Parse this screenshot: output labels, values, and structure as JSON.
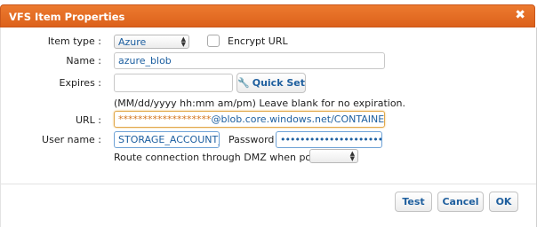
{
  "window": {
    "title": "VFS Item Properties",
    "close_glyph": "✖"
  },
  "form": {
    "item_type_label": "Item type :",
    "item_type_value": "Azure",
    "encrypt_url_label": "Encrypt URL",
    "name_label": "Name :",
    "name_value": "azure_blob",
    "expires_label": "Expires :",
    "expires_value": "",
    "quick_set_label": "Quick Set",
    "expires_hint": "(MM/dd/yyyy hh:mm am/pm) Leave blank for no expiration.",
    "url_label": "URL :",
    "url_masked": "*******************",
    "url_value": "@blob.core.windows.net/CONTAINER_NAME/",
    "username_label": "User name :",
    "username_value": "STORAGE_ACCOUNT_NA",
    "password_label": "Password :",
    "password_value": "••••••••••••••••••••••••",
    "dmz_label": "Route connection through DMZ when possible :",
    "dmz_value": ""
  },
  "footer": {
    "test_label": "Test",
    "cancel_label": "Cancel",
    "ok_label": "OK"
  },
  "colors": {
    "titlebar": "#dc611b",
    "link_blue": "#1f5f9e",
    "masked_orange": "#d4761f"
  }
}
